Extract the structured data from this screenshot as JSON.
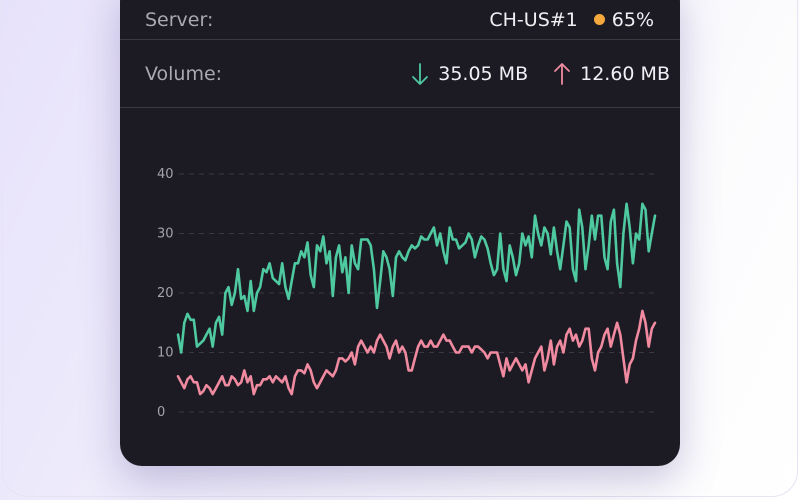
{
  "server": {
    "label": "Server:",
    "name": "CH-US#1",
    "load": "65%",
    "status_color": "#f5a93c"
  },
  "volume": {
    "label": "Volume:",
    "download": "35.05 MB",
    "upload": "12.60 MB",
    "download_icon": "arrow-down-icon",
    "upload_icon": "arrow-up-icon",
    "download_color": "#4ec9a0",
    "upload_color": "#f08aa0"
  },
  "chart_data": {
    "type": "line",
    "yticks": [
      0,
      10,
      20,
      30,
      40
    ],
    "ylim": [
      0,
      40
    ],
    "grid": true,
    "series": [
      {
        "color": "#4ec9a0",
        "values": [
          13,
          10,
          15,
          16.5,
          15.5,
          15.5,
          11,
          11.5,
          12,
          13,
          14,
          11,
          15,
          16,
          13,
          20,
          21,
          18,
          20,
          24,
          19,
          19.5,
          17,
          22,
          17,
          20,
          21,
          24,
          23.5,
          25,
          22.5,
          22,
          21.5,
          25,
          21,
          19,
          22,
          25,
          25,
          27,
          26,
          28.5,
          23,
          21,
          28,
          27,
          29.5,
          25,
          27,
          19.5,
          26,
          28,
          23.5,
          26,
          20,
          28,
          25,
          24,
          29,
          29,
          29,
          28,
          24,
          17.5,
          22,
          27,
          26,
          24,
          19.5,
          26,
          27,
          26,
          25.5,
          27,
          28,
          27.5,
          28,
          29.5,
          29,
          29,
          30,
          31,
          28,
          30,
          27,
          25,
          31,
          29,
          29,
          27.5,
          28,
          28.5,
          30,
          29,
          26,
          28,
          29.5,
          29,
          27.5,
          25,
          23,
          24,
          30,
          24,
          22,
          28,
          26,
          23,
          25,
          30,
          28,
          29.5,
          26,
          33,
          30,
          28,
          31,
          30,
          26.5,
          31,
          27,
          24,
          28,
          32,
          31,
          24,
          22,
          34,
          31,
          24,
          28,
          33,
          29,
          33,
          33,
          26,
          24,
          32,
          34,
          25,
          21,
          30,
          35,
          31,
          25,
          30,
          29,
          35,
          34,
          27,
          30,
          33
        ]
      },
      {
        "color": "#f08aa0",
        "values": [
          6,
          5,
          4,
          5.5,
          6,
          5,
          5,
          3,
          3.5,
          4.5,
          4,
          3,
          4,
          5,
          6,
          4.5,
          4.5,
          6,
          5.5,
          4.5,
          5,
          7,
          5,
          6,
          3,
          4.5,
          4.5,
          5.5,
          5.5,
          6,
          5,
          6,
          5.5,
          5,
          6,
          4,
          3,
          6,
          7,
          7,
          6.5,
          8,
          7,
          5,
          4,
          5,
          6,
          7,
          6.5,
          6,
          7,
          9,
          9,
          8.5,
          9,
          10,
          8,
          11,
          12,
          11,
          10,
          11,
          10,
          12,
          13,
          12,
          11,
          9,
          11,
          12,
          10,
          11,
          10,
          7,
          7,
          9,
          11,
          12,
          11,
          11,
          12,
          11,
          11,
          12,
          13,
          12,
          12,
          11,
          10,
          10,
          11,
          11,
          11,
          10,
          11,
          11,
          10.5,
          10,
          9,
          10,
          10,
          10,
          8,
          6,
          9,
          7,
          8,
          9,
          8,
          7,
          8,
          5,
          7,
          9,
          10,
          11,
          7,
          9,
          12,
          8,
          11,
          12,
          10,
          13,
          14,
          12,
          13,
          11,
          12,
          14,
          14,
          9,
          7,
          10,
          11,
          13,
          14,
          11,
          13,
          15,
          13,
          9,
          5,
          8,
          9,
          12,
          14,
          17,
          15,
          11,
          14,
          15
        ]
      }
    ]
  }
}
